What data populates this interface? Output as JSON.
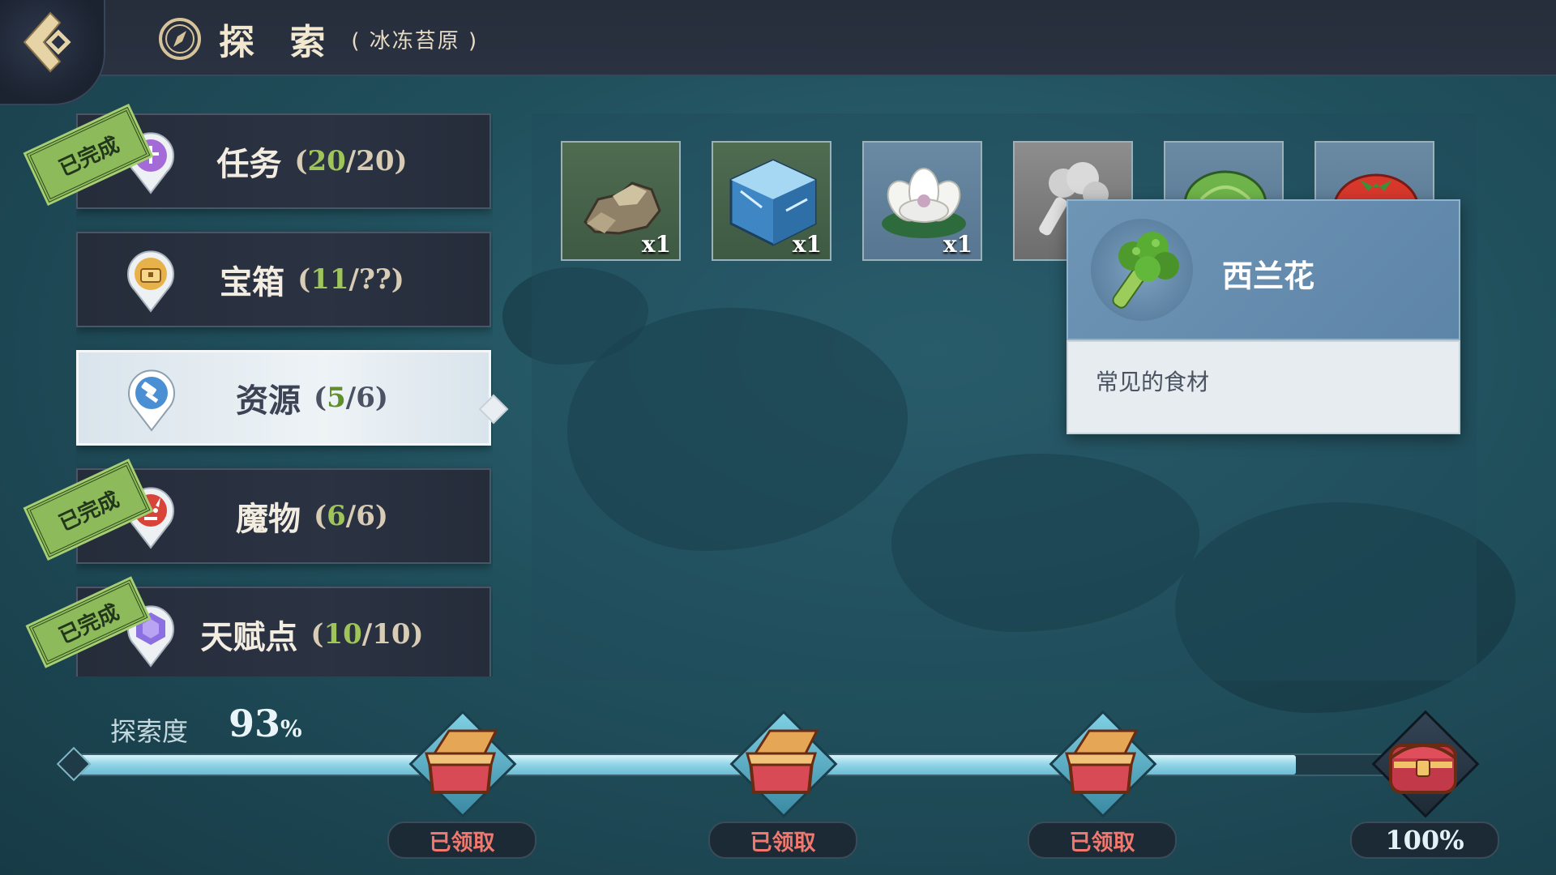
{
  "header": {
    "title": "探 索",
    "region": "( 冰冻苔原 )"
  },
  "categories": [
    {
      "label": "任务",
      "current": "20",
      "total": "/20)",
      "open": "(",
      "completed": true,
      "stamp": "已完成",
      "icon": "quest-pin-icon"
    },
    {
      "label": "宝箱",
      "current": "11",
      "total": "/??)",
      "open": "(",
      "completed": false,
      "stamp": "",
      "icon": "chest-pin-icon"
    },
    {
      "label": "资源",
      "current": "5",
      "total": "/6)",
      "open": "(",
      "completed": false,
      "stamp": "",
      "icon": "hammer-pin-icon",
      "selected": true
    },
    {
      "label": "魔物",
      "current": "6",
      "total": "/6)",
      "open": "(",
      "completed": true,
      "stamp": "已完成",
      "icon": "demon-pin-icon"
    },
    {
      "label": "天赋点",
      "current": "10",
      "total": "/10)",
      "open": "(",
      "completed": true,
      "stamp": "已完成",
      "icon": "crystal-pin-icon"
    }
  ],
  "resources": [
    {
      "icon": "rock-icon",
      "qty": "x1"
    },
    {
      "icon": "ice-cube-icon",
      "qty": "x1"
    },
    {
      "icon": "white-flower-icon",
      "qty": "x1"
    },
    {
      "icon": "broccoli-gray-icon",
      "qty": ""
    },
    {
      "icon": "cabbage-icon",
      "qty": ""
    },
    {
      "icon": "tomato-icon",
      "qty": ""
    }
  ],
  "tooltip": {
    "name": "西兰花",
    "description": "常见的食材",
    "icon": "broccoli-icon"
  },
  "progress": {
    "label": "探索度",
    "value": "93",
    "unit": "%",
    "fraction": 0.93,
    "milestones": [
      {
        "status": "已领取",
        "icon": "open-chest-icon"
      },
      {
        "status": "已领取",
        "icon": "open-chest-icon"
      },
      {
        "status": "已领取",
        "icon": "open-chest-icon"
      },
      {
        "status": "100%",
        "icon": "closed-chest-icon"
      }
    ]
  },
  "colors": {
    "accent_green": "#9ec45a",
    "claimed_red": "#f0786e",
    "panel_dark": "#2b3343"
  }
}
